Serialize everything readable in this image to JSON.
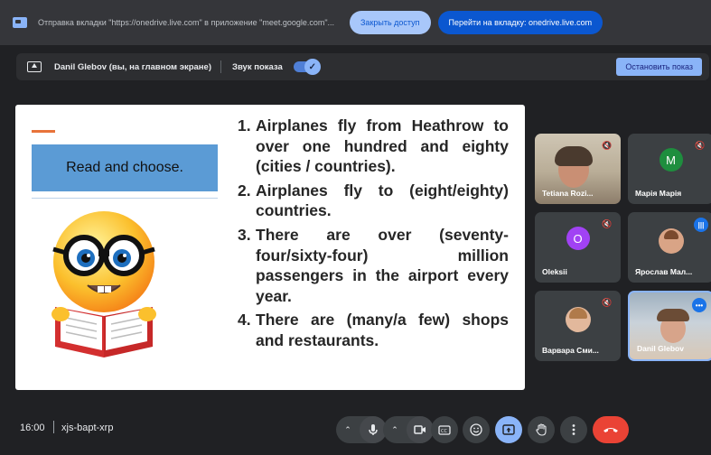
{
  "share_bar": {
    "message": "Отправка вкладки \"https://onedrive.live.com\" в приложение \"meet.google.com\"...",
    "stop_access_label": "Закрыть доступ",
    "goto_tab_label": "Перейти на вкладку: onedrive.live.com"
  },
  "present_bar": {
    "presenter_label": "Danil Glebov (вы, на главном экране)",
    "sound_label": "Звук показа",
    "sound_enabled": true,
    "stop_label": "Остановить показ"
  },
  "slide": {
    "title": "Read and choose.",
    "items": [
      {
        "num": "1.",
        "text": "Airplanes fly from Heathrow to over one hundred and eighty (cities / countries)."
      },
      {
        "num": "2.",
        "text": "Airplanes fly to (eight/eighty) countries."
      },
      {
        "num": "3.",
        "text": "There are over (seventy-four/sixty-four) million passengers in the airport every year."
      },
      {
        "num": "4.",
        "text": "There are (many/a few) shops and restaurants."
      }
    ]
  },
  "participants": [
    {
      "name": "Tetiana Rozi...",
      "muted": true,
      "avatar": "video"
    },
    {
      "name": "Марія Марія",
      "muted": true,
      "avatar": "M",
      "avatar_color": "#1e8e3e"
    },
    {
      "name": "Oleksii",
      "muted": true,
      "avatar": "O",
      "avatar_color": "#a142f4"
    },
    {
      "name": "Ярослав Мал...",
      "muted": false,
      "speaking": true,
      "avatar": "photo"
    },
    {
      "name": "Варвара Сми...",
      "muted": true,
      "avatar": "photo"
    },
    {
      "name": "Danil Glebov",
      "muted": false,
      "more": true,
      "avatar": "video"
    }
  ],
  "bottom_bar": {
    "time": "16:00",
    "meeting_code": "xjs-bapt-xrp"
  },
  "icons": {
    "mic": "mic-icon",
    "camera": "camera-icon",
    "captions": "captions-icon",
    "emoji": "emoji-icon",
    "present": "present-icon",
    "hand": "raise-hand-icon",
    "more": "more-vert-icon",
    "end_call": "end-call-icon"
  },
  "colors": {
    "background": "#202124",
    "accent": "#8ab4f8",
    "end_call": "#ea4335",
    "slide_title_box": "#5b9bd5"
  }
}
